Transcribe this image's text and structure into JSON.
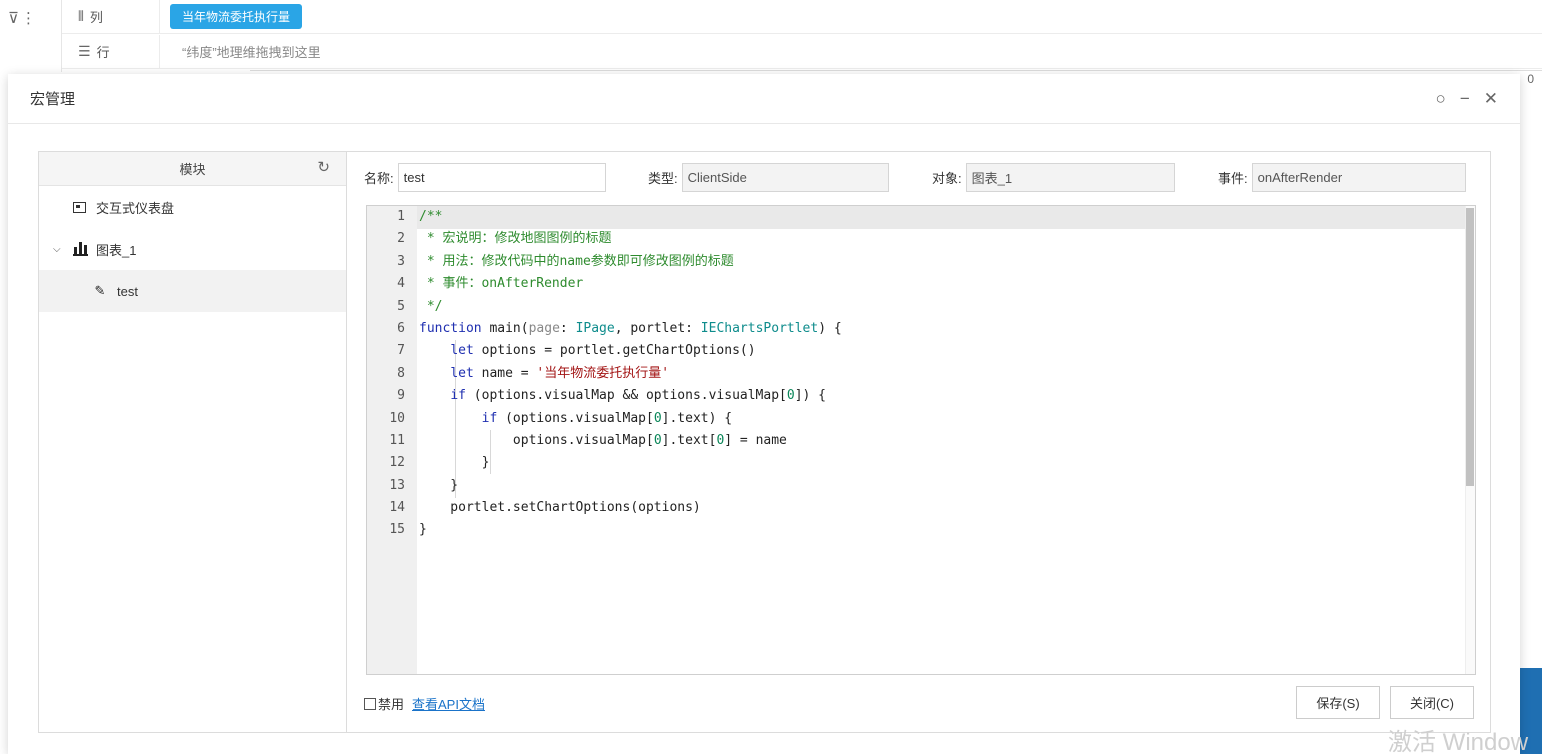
{
  "background": {
    "columns_label": "列",
    "rows_label": "行",
    "column_pill": "当年物流委托执行量",
    "row_hint": "“纬度”地理维拖拽到这里",
    "corner_value": "0",
    "watermark": "激活 Window"
  },
  "dialog": {
    "title": "宏管理",
    "refresh_icon": "refresh-icon",
    "minimize_icon": "minimize-icon",
    "close_icon": "close-icon"
  },
  "tree": {
    "header": "模块",
    "items": [
      {
        "label": "交互式仪表盘",
        "icon": "dashboard-icon"
      },
      {
        "label": "图表_1",
        "icon": "bar-chart-icon",
        "expanded": true
      },
      {
        "label": "test",
        "icon": "macro-edit-icon",
        "selected": true
      }
    ]
  },
  "form": {
    "name_label": "名称:",
    "name_value": "test",
    "type_label": "类型:",
    "type_value": "ClientSide",
    "object_label": "对象:",
    "object_value": "图表_1",
    "event_label": "事件:",
    "event_value": "onAfterRender"
  },
  "code": {
    "line_numbers": [
      "1",
      "2",
      "3",
      "4",
      "5",
      "6",
      "7",
      "8",
      "9",
      "10",
      "11",
      "12",
      "13",
      "14",
      "15"
    ]
  },
  "footer": {
    "disable_label": "禁用",
    "api_link": "查看API文档",
    "save_button": "保存(S)",
    "close_button": "关闭(C)"
  },
  "colors": {
    "accent": "#2aa5e6",
    "link": "#1a73c9",
    "comment": "#2e8b2e",
    "keyword": "#1f2fb0",
    "type": "#0e8c8c",
    "string": "#a31515"
  }
}
